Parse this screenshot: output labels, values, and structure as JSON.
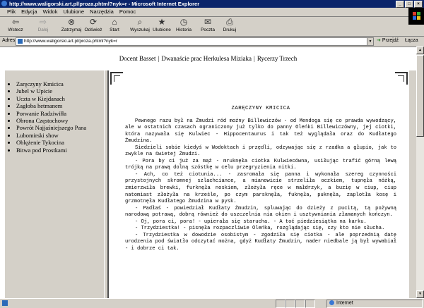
{
  "window": {
    "title": "http://www.waligorski.art.pl/proza.phtml?nyk=r - Microsoft Internet Explorer"
  },
  "menu": [
    "Plik",
    "Edycja",
    "Widok",
    "Ulubione",
    "Narzędzia",
    "Pomoc"
  ],
  "toolbar": {
    "back": "Wstecz",
    "forward": "Dalej",
    "stop": "Zatrzymaj",
    "refresh": "Odśwież",
    "home": "Start",
    "search": "Wyszukaj",
    "favorites": "Ulubione",
    "history": "Historia",
    "mail": "Poczta",
    "print": "Drukuj"
  },
  "address": {
    "label": "Adres",
    "url": "http://www.waligorski.art.pl/proza.phtml?nyk=r",
    "go": "Przejdź",
    "links": "Łącza"
  },
  "topnav": [
    "Docent Basset",
    "Dwanaście prac Herkulesa Miziaka",
    "Rycerzy Trzech"
  ],
  "sidebar": {
    "items": [
      "Zaręczyny Kmicica",
      "Jubel w Upicie",
      "Uczta w Kiejdanach",
      "Zagłoba hetmanem",
      "Porwanie Radziwiłła",
      "Obrona Częstochowy",
      "Powrót Najjaśniejszego Pana",
      "Lubomirski show",
      "Oblężenie Tykocina",
      "Bitwa pod Prostkami"
    ]
  },
  "article": {
    "title": "ZARĘCZYNY KMICICA",
    "paragraphs": [
      "Pewnego razu był na Żmudzi ród możny Billewiczów - od Mendoga się co prawda wywodzący, ale w ostatnich czasach ograniczony już tylko do panny Oleńki Billewiczówny, jej ciotki, która nazywała się Kulwiec - Hippocentaurus i tak też wyglądała oraz do Kudłatego Żmudzina.",
      "Siedzieli sobie kiedyś w Wodoktach i przędli, odzywając się z rzadka a głupio, jak to zwykle na świetej Żmudzi.",
      "- Pora by ci już za mąż - mruknęła ciotka Kulwiecówna, usiłując trafić górną lewą trójką na prawą dolną szóstkę w celu przegryzienia nitki.",
      "- Ach, co też ciotunia... - zasromała się panna i wykonała szereg czynności przystojnych skromnej szlachciance, a mianowicie strzeliła oczkiem, tupnęła nóżką, zmierzwiła brewki, furknęła noskiem, złożyła ręce w małdrzyk, a buzię w ciup, ciup natomiast złożyła na krześle, po czym parsknęła, fuknęła, puknęła, zaplotła kosę i grzmotnęła Kudłatego Żmudzina w pysk.",
      "- Padłaś - powiedział Kudłaty Żmudzin, spluwając do dzieży z pucitą, tą pożywną narodową potrawą, dobrą również do uszczelnia nia okien i usztywniania złamanych kończyn.",
      "- Oj, pora ci, pora! - upierała się starucha. - A toć piedziesiątka na karku.",
      "- Trzydziestka! - pisnęła rozpaczliwie Oleńka, rozglądając się, czy kto nie słucha.",
      "- Trzydziestka w dowodzie osobistym - zgodziła się ciotka - ale poprzednią datę urodzenia pod światło odczytać można, gdyż Kudłaty Żmudzin, nader niedbale ją był wywabiał - i dobrze ci tak."
    ]
  },
  "status": {
    "zone": "Internet"
  }
}
